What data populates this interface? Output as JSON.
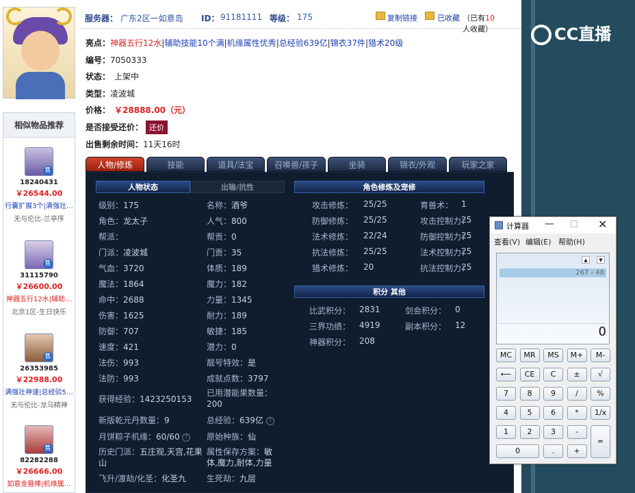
{
  "header": {
    "server_label": "服务器：",
    "server": "广东2区一如意岛",
    "id_label": "ID：",
    "id": "91181111",
    "level_label": "等级：",
    "level": "175",
    "copy_link": "复制链接",
    "collected": "已收藏",
    "collect_prefix": "（已有",
    "collect_count": "10",
    "collect_suffix": "人收藏）"
  },
  "info": {
    "highlights_label": "亮点：",
    "highlights": [
      "神器五行12水",
      "辅助技能10个满",
      "机缘属性优秀",
      "总经验639亿",
      "锦衣37件",
      "猎术20级"
    ],
    "number_label": "编号：",
    "number": "7050333",
    "status_label": "状态：",
    "status": "上架中",
    "type_label": "类型：",
    "type": "凌波城",
    "price_label": "价格：",
    "price": "￥28888.00（元）",
    "bargain_label": "是否接受还价：",
    "bargain_btn": "还价",
    "time_label": "出售剩余时间：",
    "time": "11天16时"
  },
  "tabs": [
    "人物/修炼",
    "技能",
    "道具/法宝",
    "召唤兽/孩子",
    "坐骑",
    "锦衣/外观",
    "玩家之家"
  ],
  "sections": {
    "char_state": "人物状态",
    "outside": "出输/抗性",
    "cultivation": "角色修炼及宠修",
    "points": "积分 其他"
  },
  "stats_left": [
    [
      "级别：",
      "175"
    ],
    [
      "角色：",
      "龙太子"
    ],
    [
      "帮派：",
      ""
    ],
    [
      "门派：",
      "凌波城"
    ],
    [
      "气血：",
      "3720"
    ],
    [
      "魔法：",
      "1864"
    ],
    [
      "命中：",
      "2688"
    ],
    [
      "伤害：",
      "1625"
    ],
    [
      "防御：",
      "707"
    ],
    [
      "速度：",
      "421"
    ],
    [
      "法伤：",
      "993"
    ],
    [
      "法防：",
      "993"
    ]
  ],
  "stats_mid": [
    [
      "名称：",
      "酒爷"
    ],
    [
      "人气：",
      "800"
    ],
    [
      "帮贡：",
      "0"
    ],
    [
      "门贡：",
      "35"
    ],
    [
      "体质：",
      "189"
    ],
    [
      "魔力：",
      "182"
    ],
    [
      "力量：",
      "1345"
    ],
    [
      "耐力：",
      "189"
    ],
    [
      "敏捷：",
      "185"
    ],
    [
      "潜力：",
      "0"
    ],
    [
      "靓号特效：",
      "是"
    ],
    [
      "成就点数：",
      "3797"
    ]
  ],
  "stats_extra": {
    "exp_label": "获得经验：",
    "exp": "1423250153",
    "pot_label": "已用潜能果数量：",
    "pot": "200",
    "qianyuan_label": "新版乾元丹数量：",
    "qianyuan": "9",
    "total_exp_label": "总经验：",
    "total_exp": "639亿",
    "zongzi_label": "月饼粽子机缘：",
    "zongzi": "60/60",
    "race_label": "原始种族：",
    "race": "仙",
    "history_label": "历史门派：",
    "history": "五庄观,天宫,花果山",
    "attr_label": "属性保存方案：",
    "attr": "敏体,魔力,耐体,力量",
    "fly_label": "飞升/渡劫/化圣：",
    "fly": "化圣九",
    "life_label": "生死劫：",
    "life": "九层"
  },
  "cult": [
    [
      "攻击修炼：",
      "25/25"
    ],
    [
      "防御修炼：",
      "25/25"
    ],
    [
      "法术修炼：",
      "22/24"
    ],
    [
      "抗法修炼：",
      "25/25"
    ],
    [
      "猎术修炼：",
      "20"
    ]
  ],
  "cult2": [
    [
      "育兽术：",
      "1"
    ],
    [
      "攻击控制力：",
      "25"
    ],
    [
      "防御控制力：",
      "25"
    ],
    [
      "法术控制力：",
      "25"
    ],
    [
      "抗法控制力：",
      "25"
    ]
  ],
  "points": [
    [
      "比武积分：",
      "2831"
    ],
    [
      "三界功绩：",
      "4919"
    ],
    [
      "神器积分：",
      "208"
    ]
  ],
  "points2": [
    [
      "剑会积分：",
      "0"
    ],
    [
      "副本积分：",
      "12"
    ]
  ],
  "sidebar": {
    "title": "相似物品推荐",
    "items": [
      {
        "id": "18240431",
        "price": "￥26544.00",
        "tags": "行囊扩展3个|满强壮…",
        "server": "无与伦比-兰亭序",
        "sold": "售"
      },
      {
        "id": "31115790",
        "price": "￥26600.00",
        "tags": "神器五行12水|辅助…",
        "server": "北京1区-生日快乐",
        "sold": "售"
      },
      {
        "id": "26353985",
        "price": "￥22988.00",
        "tags": "满强壮神速|总经验5…",
        "server": "无与伦比-龙马精神",
        "sold": "售"
      },
      {
        "id": "82282288",
        "price": "￥26666.00",
        "tags": "如意金箍棒|机缘属…",
        "server": "",
        "sold": "售"
      }
    ]
  },
  "logo": "CC直播",
  "calculator": {
    "title": "计算器",
    "menu": [
      "查看(V)",
      "编辑(E)",
      "帮助(H)"
    ],
    "history": "267 - 48",
    "display": "0",
    "buttons": [
      [
        "MC",
        "MR",
        "MS",
        "M+",
        "M-"
      ],
      [
        "⟵",
        "CE",
        "C",
        "±",
        "√"
      ],
      [
        "7",
        "8",
        "9",
        "/",
        "%"
      ],
      [
        "4",
        "5",
        "6",
        "*",
        "1/x"
      ],
      [
        "1",
        "2",
        "3",
        "-",
        "="
      ],
      [
        "0",
        ".",
        "+"
      ]
    ]
  }
}
